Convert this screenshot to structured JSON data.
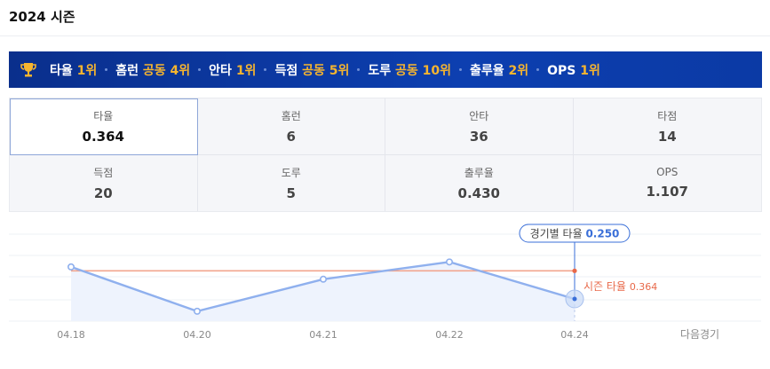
{
  "season_title": "2024 시즌",
  "rankings": [
    {
      "label": "타율",
      "value": "1위"
    },
    {
      "label": "홈런",
      "value": "공동 4위"
    },
    {
      "label": "안타",
      "value": "1위"
    },
    {
      "label": "득점",
      "value": "공동 5위"
    },
    {
      "label": "도루",
      "value": "공동 10위"
    },
    {
      "label": "출루율",
      "value": "2위"
    },
    {
      "label": "OPS",
      "value": "1위"
    }
  ],
  "stats": [
    {
      "label": "타율",
      "value": "0.364"
    },
    {
      "label": "홈런",
      "value": "6"
    },
    {
      "label": "안타",
      "value": "36"
    },
    {
      "label": "타점",
      "value": "14"
    },
    {
      "label": "득점",
      "value": "20"
    },
    {
      "label": "도루",
      "value": "5"
    },
    {
      "label": "출루율",
      "value": "0.430"
    },
    {
      "label": "OPS",
      "value": "1.107"
    }
  ],
  "colors": {
    "banner": "#0d3fb0",
    "rank_value": "#f6b52f",
    "line": "#8fb0ee",
    "season_line": "#f2a58e",
    "season_text": "#e8694a",
    "tooltip": "#3a6fd8"
  },
  "chart_data": {
    "type": "line",
    "categories": [
      "04.18",
      "04.20",
      "04.21",
      "04.22",
      "04.24"
    ],
    "next_label": "다음경기",
    "series": [
      {
        "values": [
          0.38,
          0.2,
          0.33,
          0.4,
          0.25
        ]
      }
    ],
    "season_avg": {
      "label": "시즌 타율",
      "value": 0.364,
      "text": "0.364"
    },
    "tooltip": {
      "label": "경기별 타율",
      "value": "0.250",
      "index": 4
    },
    "ylim": [
      0.16,
      0.52
    ],
    "grid": true
  }
}
